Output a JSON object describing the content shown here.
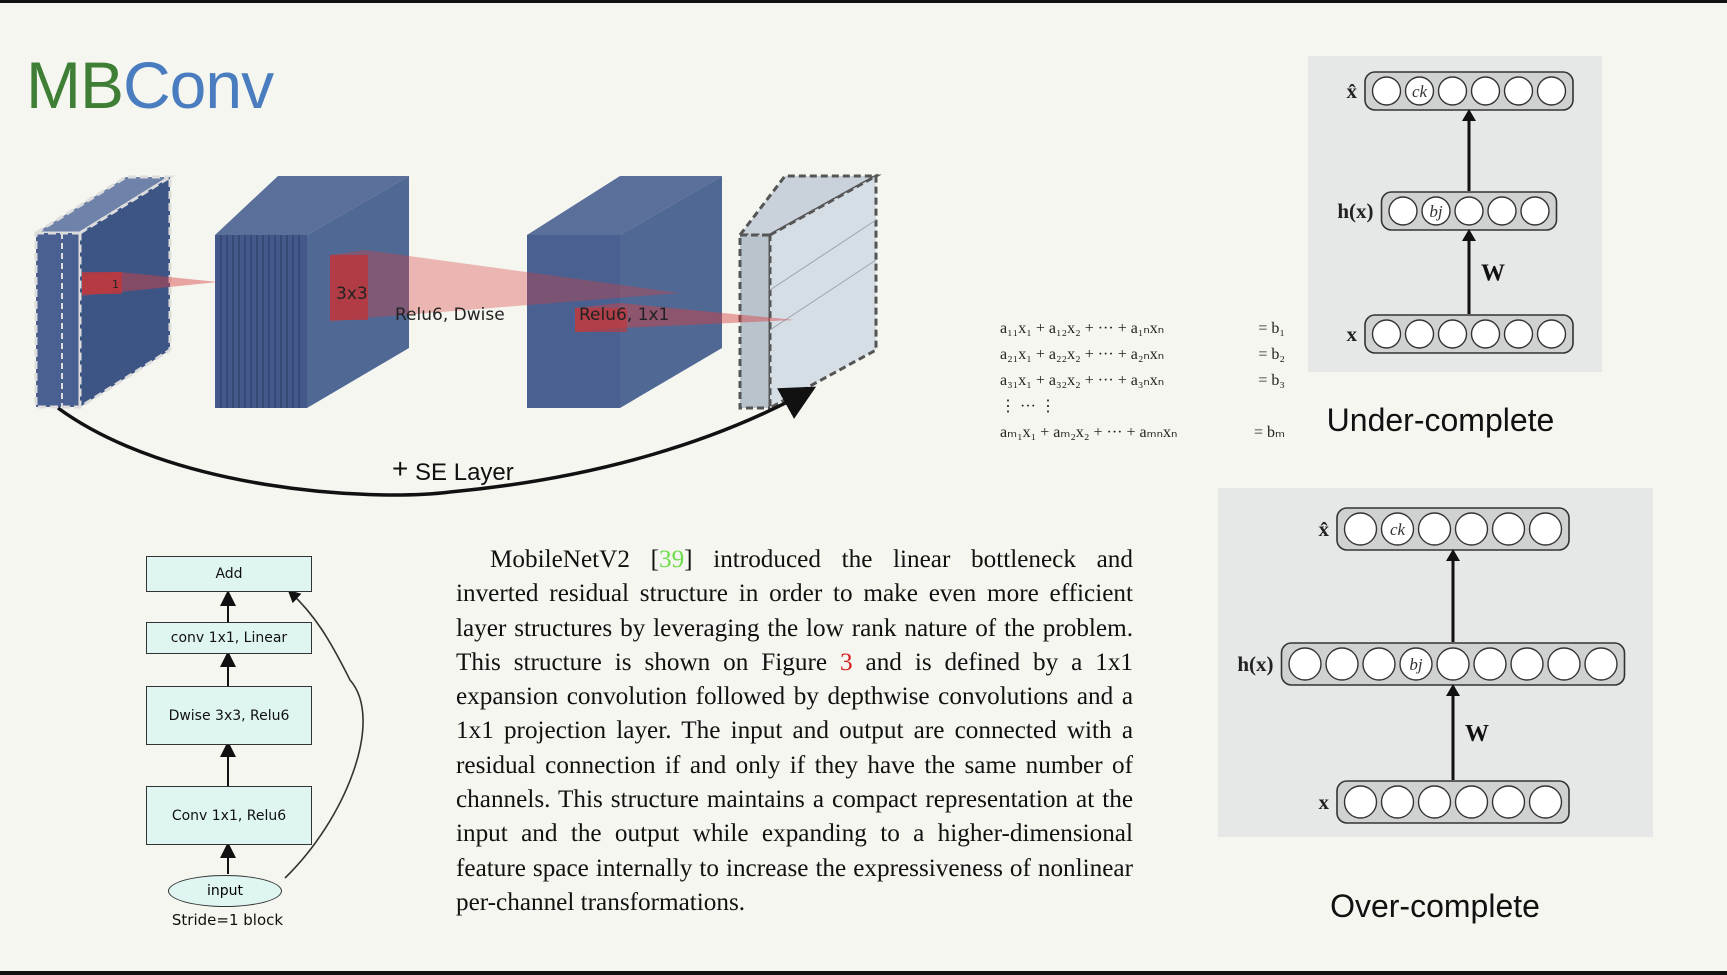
{
  "title": {
    "part1": "MB",
    "part2": "Conv"
  },
  "block_diagram": {
    "kernel_label_1": "1",
    "kernel_label_2": "3x3",
    "op_label_1": "Relu6, Dwise",
    "op_label_2": "Relu6, 1x1",
    "skip_label": "SE Layer",
    "skip_symbol": "+"
  },
  "flowchart": {
    "add": "Add",
    "conv_linear": "conv 1x1, Linear",
    "dwise": "Dwise 3x3, Relu6",
    "conv_relu": "Conv 1x1, Relu6",
    "input": "input",
    "caption": "Stride=1 block"
  },
  "paper": {
    "before_cite": "MobileNetV2 [",
    "cite_1": "39",
    "middle": "] introduced the linear bottleneck and inverted residual structure in order to make even more efficient layer structures by leveraging the low rank nature of the problem.  This structure is shown on Figure ",
    "cite_2": "3",
    "after": " and is defined by a 1x1 expansion convolution followed by depthwise convolutions and a 1x1 projection layer. The input and output are connected with a residual connection if and only if they have the same number of channels.  This structure maintains a compact representation at the input and the output while expanding to a higher-dimensional feature space internally to increase the expressiveness of nonlinear per-channel transformations."
  },
  "equations": [
    {
      "lhs": "a₁₁x₁ + a₁₂x₂ + ··· + a₁ₙxₙ",
      "rhs": "= b₁"
    },
    {
      "lhs": "a₂₁x₁ + a₂₂x₂ + ··· + a₂ₙxₙ",
      "rhs": "= b₂"
    },
    {
      "lhs": "a₃₁x₁ + a₃₂x₂ + ··· + a₃ₙxₙ",
      "rhs": "= b₃"
    },
    {
      "lhs": "⋮            ···            ⋮",
      "rhs": ""
    },
    {
      "lhs": "aₘ₁x₁ + aₘ₂x₂ + ··· + aₘₙxₙ",
      "rhs": "= bₘ"
    }
  ],
  "autoencoders": {
    "top": {
      "caption": "Under-complete",
      "x_hat_label": "x̂",
      "h_label": "h(x)",
      "x_label": "x",
      "w_label": "W",
      "c_label": "ck",
      "b_label": "bj",
      "output_units": 6,
      "hidden_units": 5,
      "input_units": 6
    },
    "bottom": {
      "caption": "Over-complete",
      "x_hat_label": "x̂",
      "h_label": "h(x)",
      "x_label": "x",
      "w_label": "W",
      "c_label": "ck",
      "b_label": "bj",
      "output_units": 6,
      "hidden_units": 9,
      "input_units": 6
    }
  },
  "colors": {
    "title_green": "#3f7f35",
    "title_blue": "#4a7cc0",
    "block_blue": "#4f6894",
    "flow_fill": "#dff5f2",
    "citation_green": "#6fdc4a",
    "citation_red": "#d42020"
  }
}
